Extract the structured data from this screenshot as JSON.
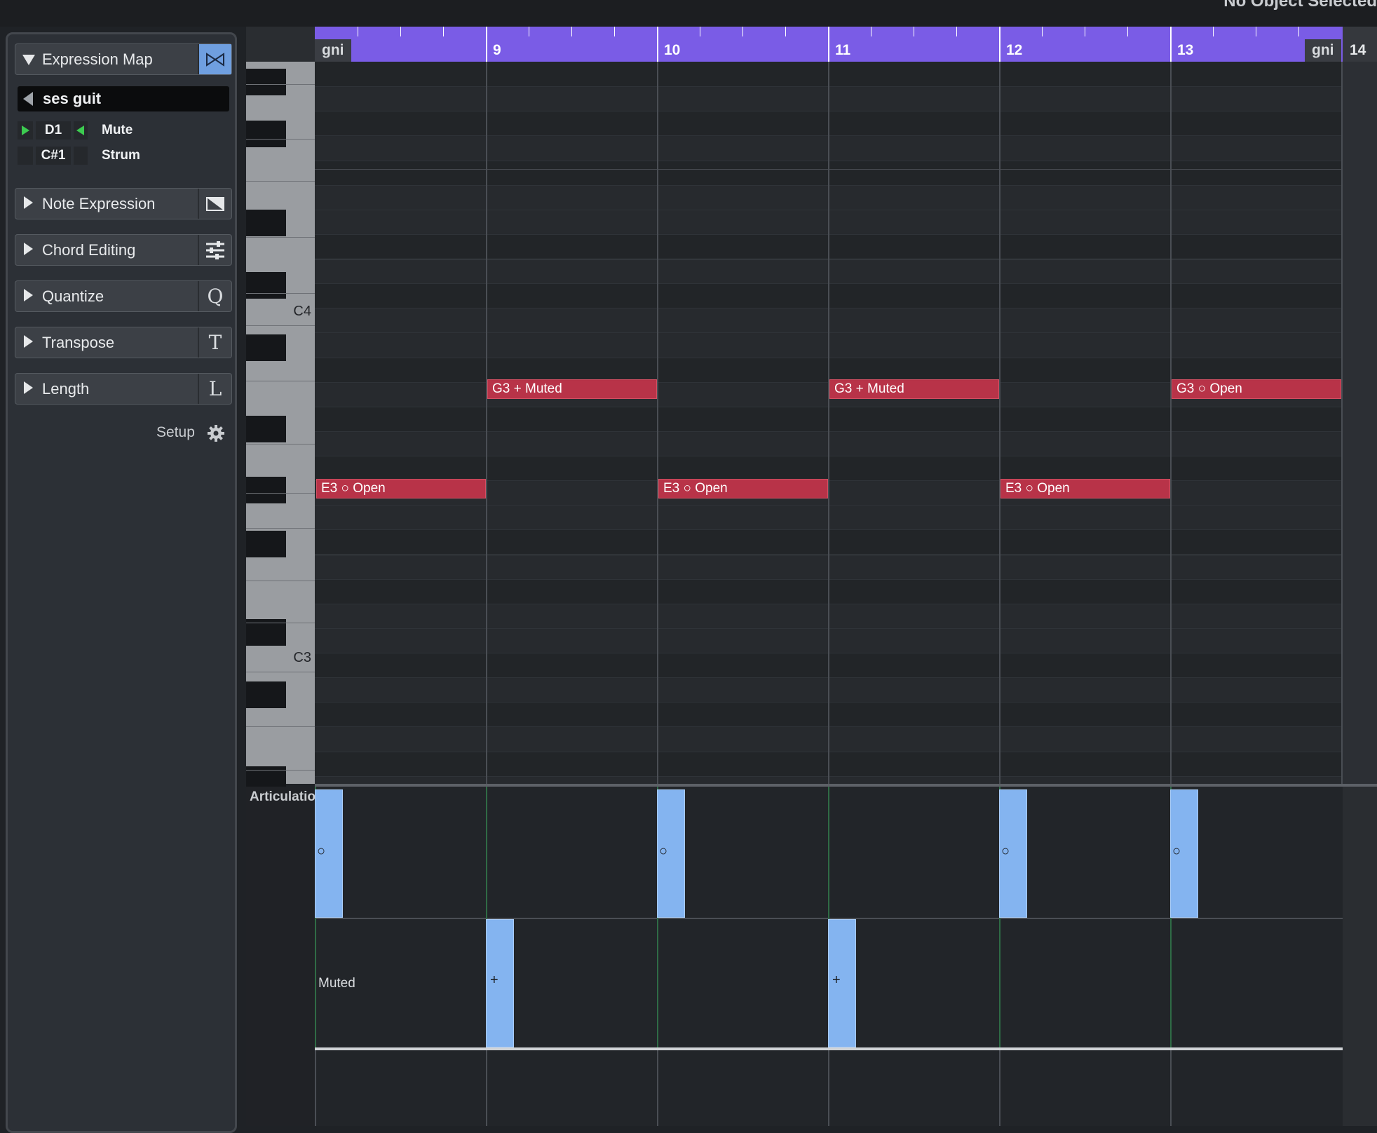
{
  "topbar": {
    "status": "No Object Selected"
  },
  "inspector": {
    "expression_map": {
      "label": "Expression Map",
      "map_name": "ses guit"
    },
    "articulations": [
      {
        "note": "D1",
        "name": "Mute",
        "active": true
      },
      {
        "note": "C#1",
        "name": "Strum",
        "active": false
      }
    ],
    "sections": [
      {
        "label": "Note Expression",
        "icon": "note-expression-icon"
      },
      {
        "label": "Chord Editing",
        "icon": "chord-editing-icon",
        "glyph": ""
      },
      {
        "label": "Quantize",
        "icon": "quantize-icon",
        "glyph": "Q"
      },
      {
        "label": "Transpose",
        "icon": "transpose-icon",
        "glyph": "T"
      },
      {
        "label": "Length",
        "icon": "length-icon",
        "glyph": "L"
      }
    ],
    "setup_label": "Setup"
  },
  "ruler": {
    "bars": [
      "9",
      "10",
      "11",
      "12",
      "13"
    ],
    "left_tag": "gni",
    "right_tag": "gni",
    "end_bar": "14"
  },
  "keyboard": {
    "c4_label": "C4",
    "c3_label": "C3"
  },
  "notes": [
    {
      "text": "E3 ○ Open"
    },
    {
      "text": "G3 + Muted"
    },
    {
      "text": "E3 ○ Open"
    },
    {
      "text": "G3 + Muted"
    },
    {
      "text": "E3 ○ Open"
    },
    {
      "text": "G3 ○ Open"
    }
  ],
  "articulation_lane": {
    "label": "Articulations",
    "rows": [
      "",
      "Muted"
    ],
    "open_symbol": "○",
    "muted_symbol": "+"
  },
  "colors": {
    "ruler": "#7a5ce6",
    "note": "#b83348",
    "lane_block": "#84b4f0",
    "active_led": "#3ccb50"
  }
}
